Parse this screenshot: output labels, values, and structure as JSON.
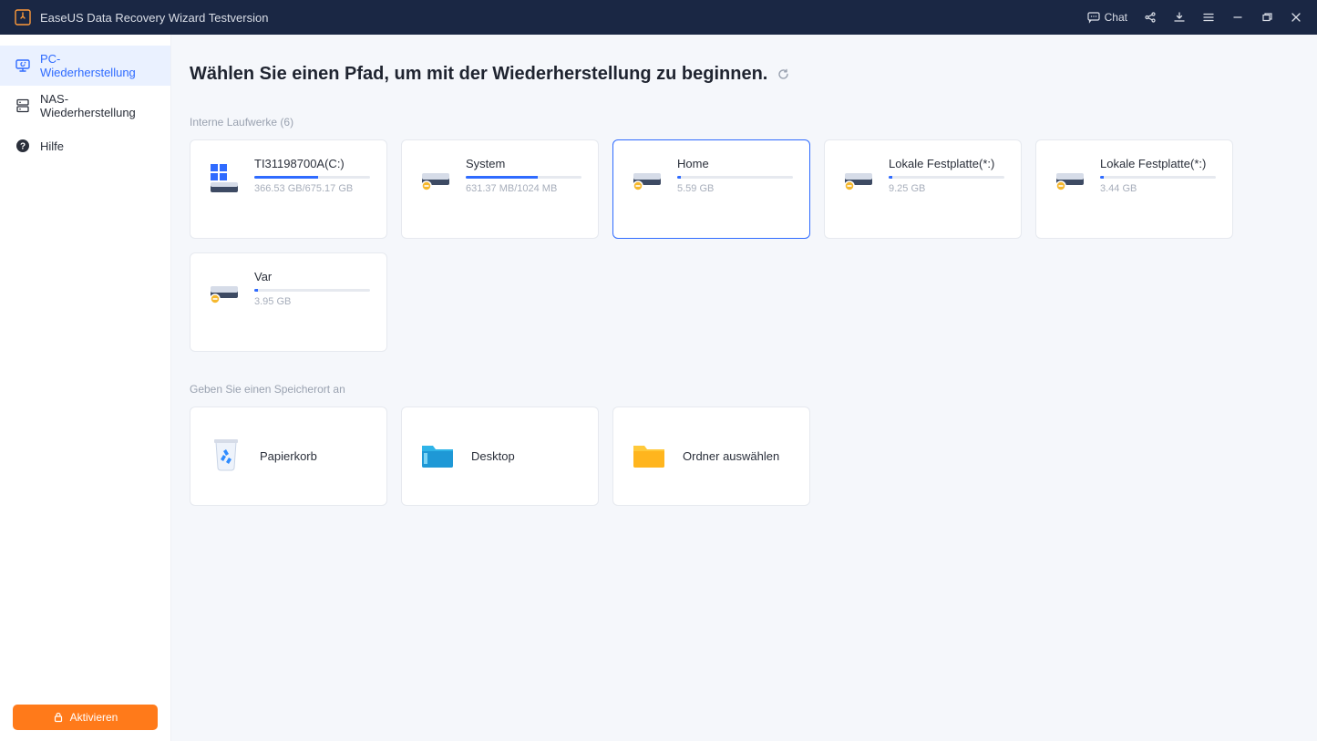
{
  "titlebar": {
    "title": "EaseUS Data Recovery Wizard Testversion",
    "chat_label": "Chat"
  },
  "sidebar": {
    "items": [
      {
        "label": "PC-Wiederherstellung",
        "active": true
      },
      {
        "label": "NAS-Wiederherstellung",
        "active": false
      },
      {
        "label": "Hilfe",
        "active": false
      }
    ],
    "activate_label": "Aktivieren"
  },
  "main": {
    "heading": "Wählen Sie einen Pfad, um mit der Wiederherstellung zu beginnen.",
    "drives_label": "Interne Laufwerke (6)",
    "drives": [
      {
        "name": "TI31198700A(C:)",
        "meta": "366.53 GB/675.17 GB",
        "fill_pct": 55,
        "icon": "windows",
        "selected": false
      },
      {
        "name": "System",
        "meta": "631.37 MB/1024 MB",
        "fill_pct": 62,
        "icon": "drive-linux",
        "selected": false
      },
      {
        "name": "Home",
        "meta": "5.59 GB",
        "fill_pct": 3,
        "icon": "drive-linux",
        "selected": true
      },
      {
        "name": "Lokale Festplatte(*:)",
        "meta": "9.25 GB",
        "fill_pct": 3,
        "icon": "drive-linux",
        "selected": false
      },
      {
        "name": "Lokale Festplatte(*:)",
        "meta": "3.44 GB",
        "fill_pct": 3,
        "icon": "drive-linux",
        "selected": false
      },
      {
        "name": "Var",
        "meta": "3.95 GB",
        "fill_pct": 3,
        "icon": "drive-linux",
        "selected": false
      }
    ],
    "locations_label": "Geben Sie einen Speicherort an",
    "locations": [
      {
        "name": "Papierkorb",
        "icon": "recycle"
      },
      {
        "name": "Desktop",
        "icon": "desktop-folder"
      },
      {
        "name": "Ordner auswählen",
        "icon": "folder"
      }
    ]
  }
}
